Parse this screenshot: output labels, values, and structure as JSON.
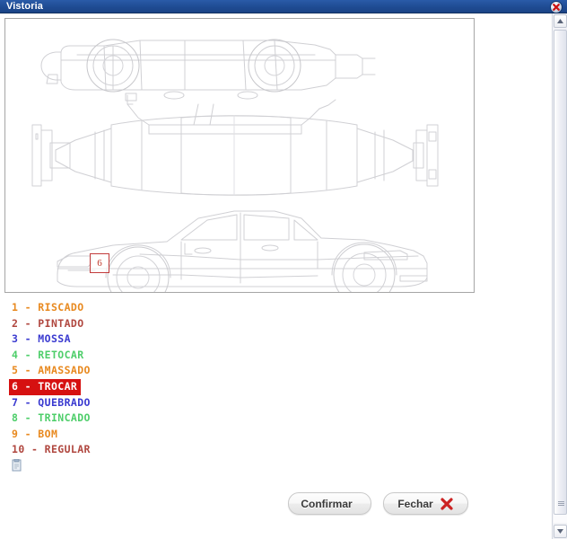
{
  "window": {
    "title": "Vistoria",
    "close_icon": "close-circle-icon",
    "titlebar_color": "#1f4b93"
  },
  "diagram": {
    "name": "vehicle-inspection-diagram",
    "views": [
      "top-side-inverted-view",
      "roof-top-view",
      "side-view"
    ],
    "marker": {
      "label": "6",
      "color": "#c0392b",
      "border_color": "#c23b3b"
    }
  },
  "legend": {
    "icon_name": "clipboard-icon",
    "items": [
      {
        "number": "1",
        "label": "1 - RISCADO",
        "color": "#e8891f",
        "background": "transparent",
        "selected": false
      },
      {
        "number": "2",
        "label": "2 - PINTADO",
        "color": "#b0473f",
        "background": "transparent",
        "selected": false
      },
      {
        "number": "3",
        "label": "3 - MOSSA",
        "color": "#3a3ad0",
        "background": "transparent",
        "selected": false
      },
      {
        "number": "4",
        "label": "4 - RETOCAR",
        "color": "#4ece6a",
        "background": "transparent",
        "selected": false
      },
      {
        "number": "5",
        "label": "5 - AMASSADO",
        "color": "#e8891f",
        "background": "transparent",
        "selected": false
      },
      {
        "number": "6",
        "label": "6 - TROCAR",
        "color": "#ffffff",
        "background": "#d61111",
        "selected": true
      },
      {
        "number": "7",
        "label": "7 - QUEBRADO",
        "color": "#3a3ad0",
        "background": "transparent",
        "selected": false
      },
      {
        "number": "8",
        "label": "8 - TRINCADO",
        "color": "#4ece6a",
        "background": "transparent",
        "selected": false
      },
      {
        "number": "9",
        "label": "9 - BOM",
        "color": "#e8891f",
        "background": "transparent",
        "selected": false
      },
      {
        "number": "10",
        "label": "10 - REGULAR",
        "color": "#b0473f",
        "background": "transparent",
        "selected": false
      }
    ]
  },
  "buttons": {
    "confirm": {
      "label": "Confirmar",
      "icon": "check-icon",
      "icon_color": "#5cb82b"
    },
    "close": {
      "label": "Fechar",
      "icon": "x-icon",
      "icon_color": "#cc2222"
    }
  },
  "scrollbar": {
    "up_icon": "chevron-up-icon",
    "down_icon": "chevron-down-icon"
  }
}
